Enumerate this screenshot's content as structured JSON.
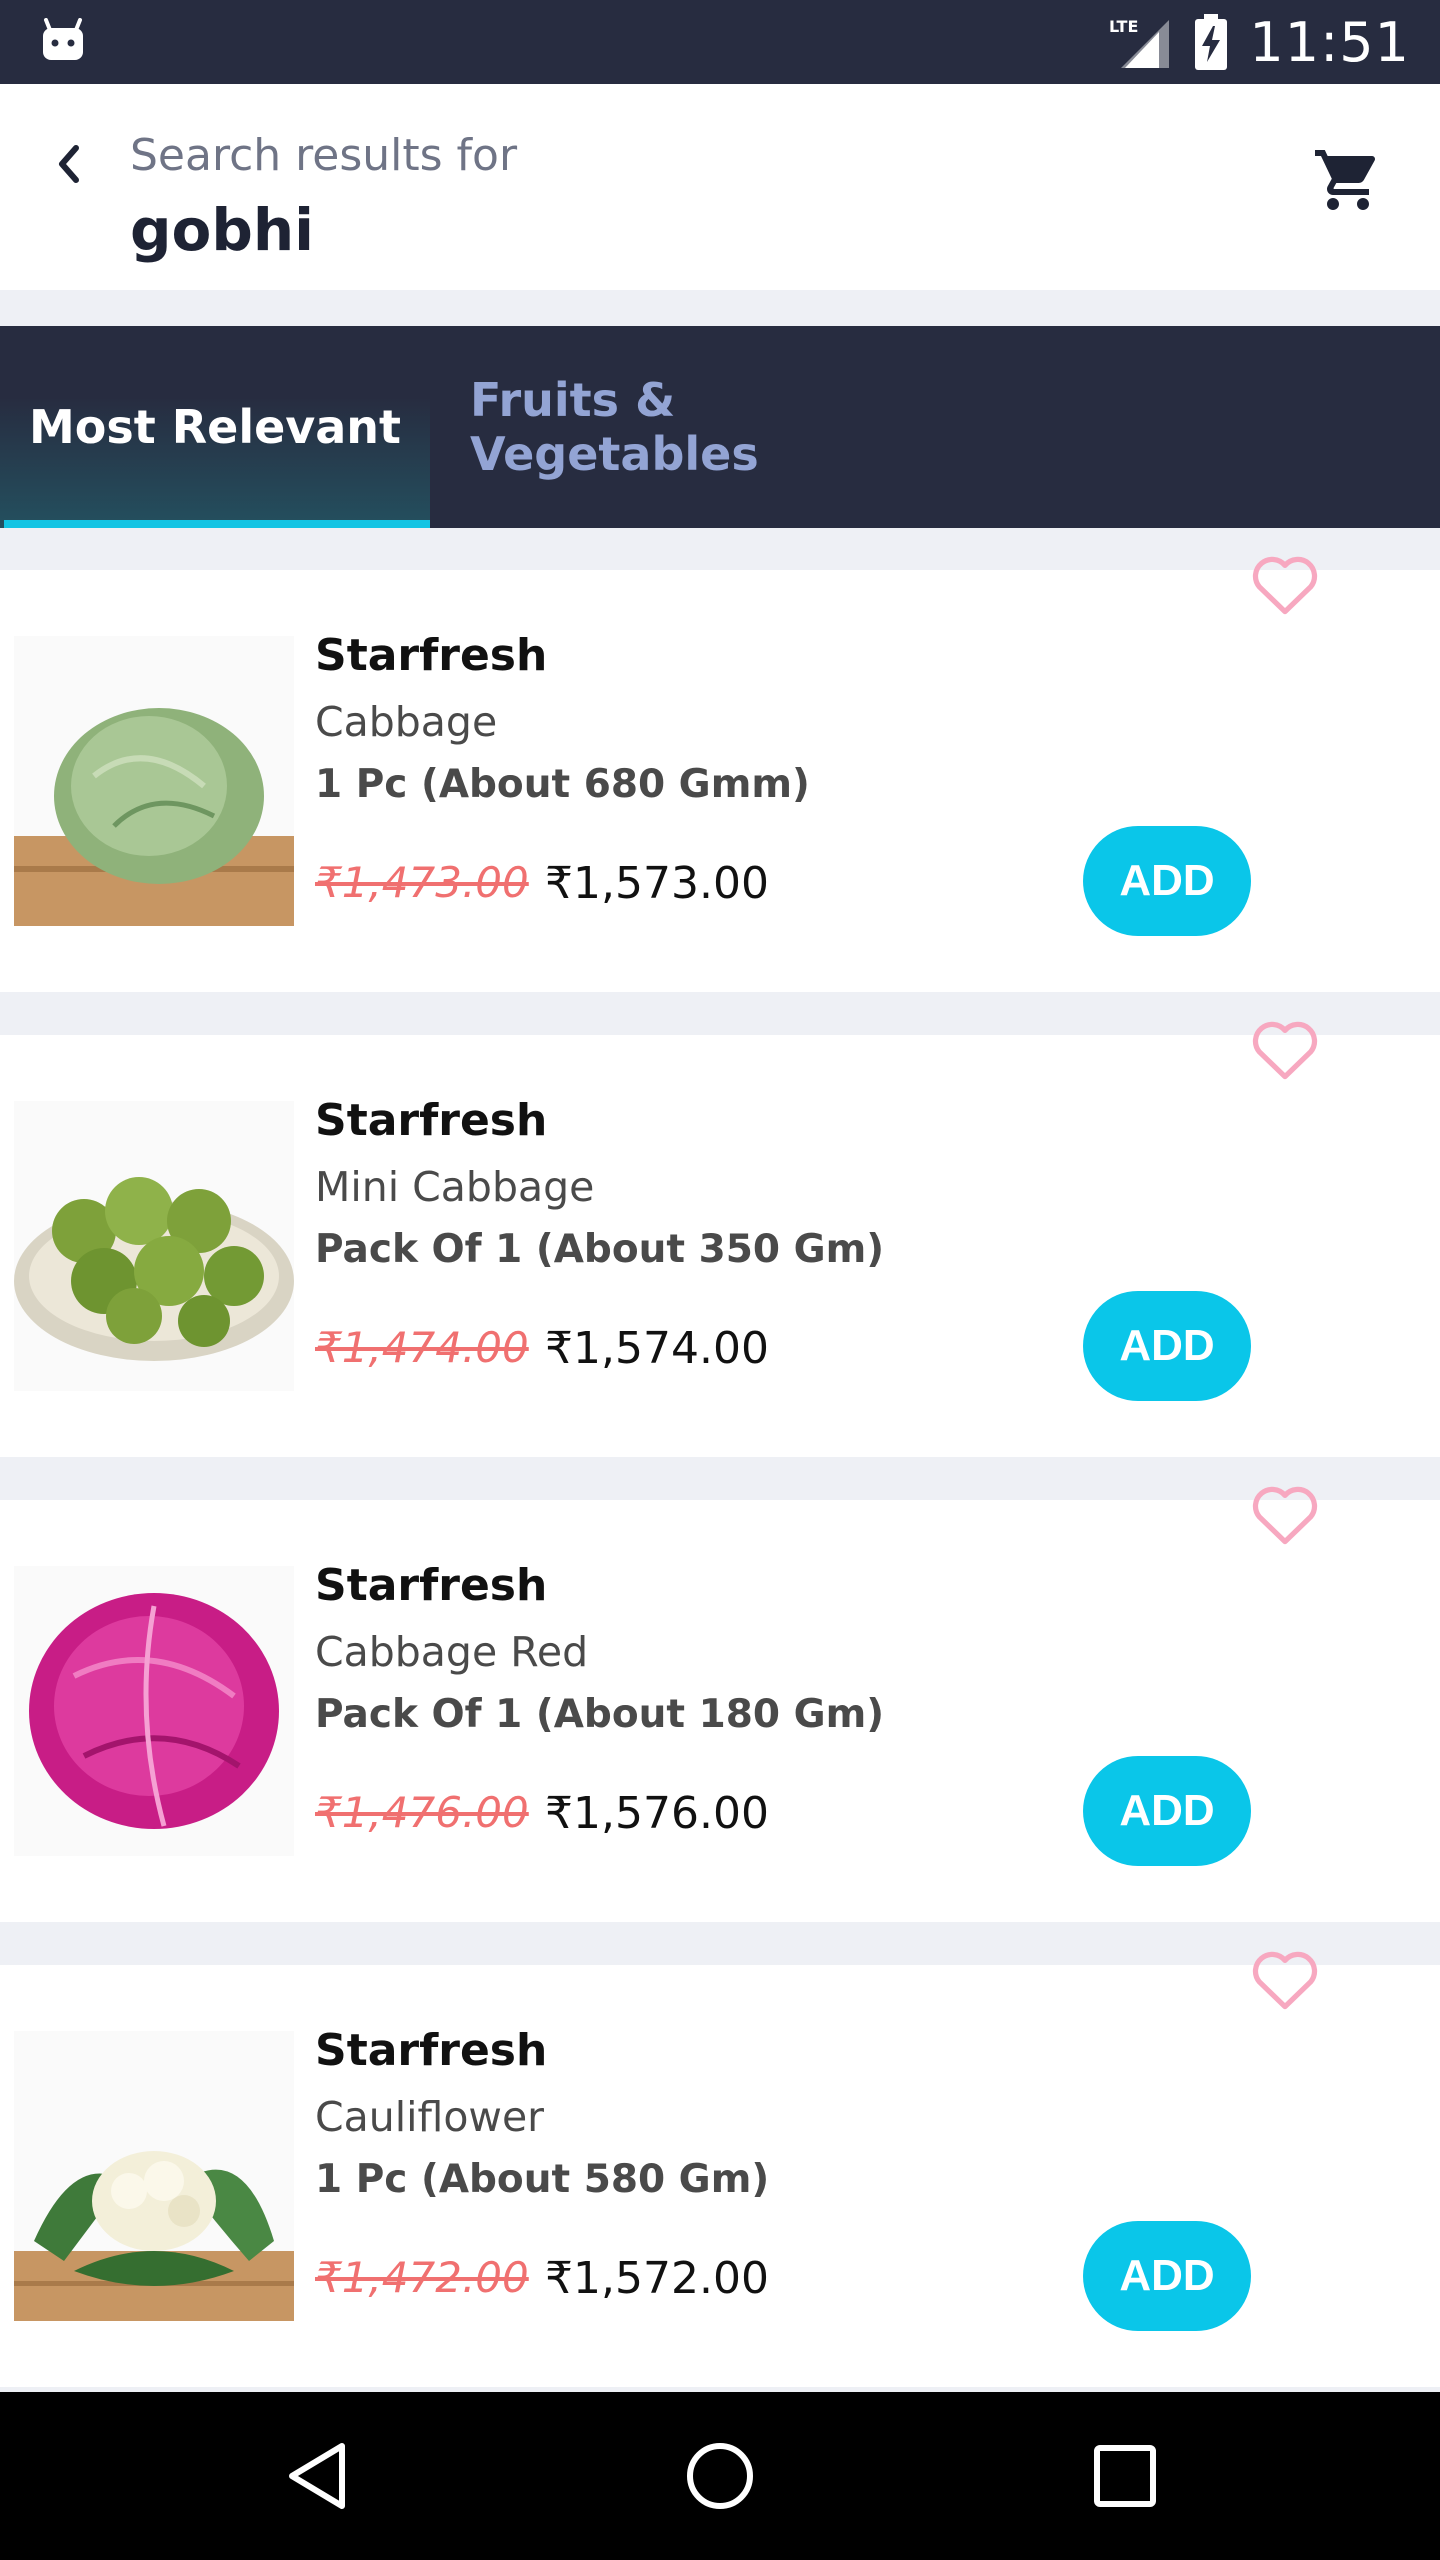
{
  "status_bar": {
    "time": "11:51",
    "network": "LTE",
    "icons": [
      "android-icon",
      "lte-signal-icon",
      "battery-charging-icon"
    ]
  },
  "header": {
    "subtitle": "Search results for",
    "query": "gobhi",
    "back_icon": "chevron-left-icon",
    "cart_icon": "shopping-cart-icon"
  },
  "tabs": [
    {
      "label": "Most Relevant",
      "active": true
    },
    {
      "label": "Fruits & Vegetables",
      "active": false
    }
  ],
  "products": [
    {
      "brand": "Starfresh",
      "name": "Cabbage",
      "quantity": "1 Pc (About 680  Gmm)",
      "old_price": "₹1,473.00",
      "price": "₹1,573.00",
      "add_label": "ADD",
      "image": "green-cabbage"
    },
    {
      "brand": "Starfresh",
      "name": "Mini Cabbage",
      "quantity": "Pack Of 1 (About 350 Gm)",
      "old_price": "₹1,474.00",
      "price": "₹1,574.00",
      "add_label": "ADD",
      "image": "brussels-sprouts"
    },
    {
      "brand": "Starfresh",
      "name": "Cabbage Red",
      "quantity": "Pack Of 1 (About 180 Gm)",
      "old_price": "₹1,476.00",
      "price": "₹1,576.00",
      "add_label": "ADD",
      "image": "red-cabbage"
    },
    {
      "brand": "Starfresh",
      "name": "Cauliflower",
      "quantity": "1 Pc (About 580 Gm)",
      "old_price": "₹1,472.00",
      "price": "₹1,572.00",
      "add_label": "ADD",
      "image": "cauliflower"
    }
  ],
  "colors": {
    "accent": "#0ac6e9",
    "header_dark": "#272c40",
    "strike_price": "#f07070",
    "heart": "#f7a8c0",
    "tab_inactive": "#93a4d4"
  },
  "nav_bar": {
    "icons": [
      "back-triangle-icon",
      "home-circle-icon",
      "recents-square-icon"
    ]
  }
}
